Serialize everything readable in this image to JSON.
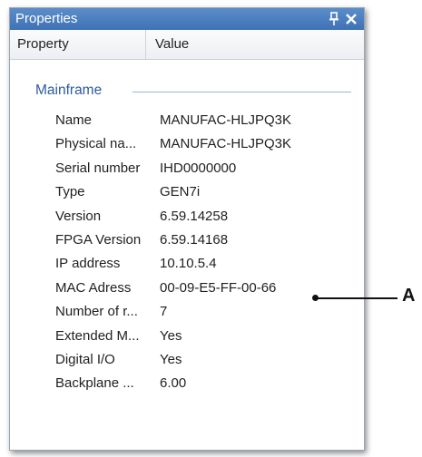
{
  "window": {
    "title": "Properties"
  },
  "columns": {
    "property": "Property",
    "value": "Value"
  },
  "group": {
    "label": "Mainframe"
  },
  "rows": [
    {
      "name": "Name",
      "value": "MANUFAC-HLJPQ3K"
    },
    {
      "name": "Physical na...",
      "value": "MANUFAC-HLJPQ3K"
    },
    {
      "name": "Serial number",
      "value": "IHD0000000"
    },
    {
      "name": "Type",
      "value": "GEN7i"
    },
    {
      "name": "Version",
      "value": "6.59.14258"
    },
    {
      "name": "FPGA Version",
      "value": "6.59.14168"
    },
    {
      "name": "IP address",
      "value": "10.10.5.4"
    },
    {
      "name": "MAC Adress",
      "value": "00-09-E5-FF-00-66"
    },
    {
      "name": "Number of r...",
      "value": "7"
    },
    {
      "name": "Extended M...",
      "value": "Yes"
    },
    {
      "name": "Digital I/O",
      "value": "Yes"
    },
    {
      "name": "Backplane ...",
      "value": "6.00"
    }
  ],
  "callout": {
    "label": "A"
  },
  "icons": {
    "pin": "pin-icon",
    "close": "close-icon"
  },
  "colors": {
    "titlebar": "#4a7fc1",
    "group_text": "#2d5aa0"
  }
}
